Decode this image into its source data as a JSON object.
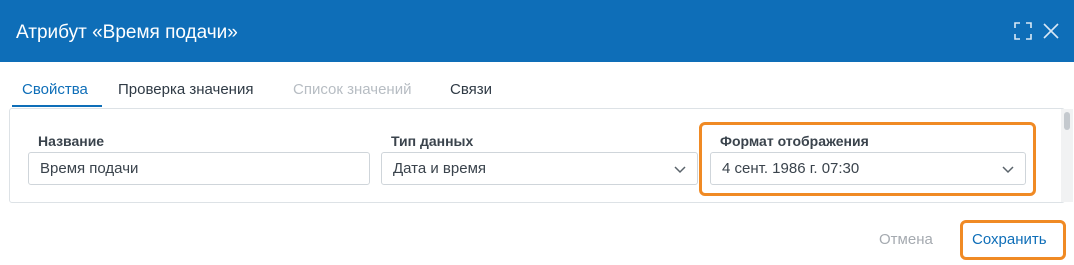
{
  "dialog": {
    "title": "Атрибут «Время подачи»",
    "icons": [
      "expand-icon",
      "close-icon"
    ]
  },
  "tabs": [
    {
      "label": "Свойства",
      "state": "active"
    },
    {
      "label": "Проверка значения",
      "state": "normal"
    },
    {
      "label": "Список значений",
      "state": "disabled"
    },
    {
      "label": "Связи",
      "state": "normal"
    }
  ],
  "fields": {
    "name": {
      "label": "Название",
      "value": "Время подачи"
    },
    "data_type": {
      "label": "Тип данных",
      "value": "Дата и время"
    },
    "display_format": {
      "label": "Формат отображения",
      "value": "4 сент. 1986 г. 07:30"
    }
  },
  "footer": {
    "cancel_label": "Отмена",
    "save_label": "Сохранить"
  },
  "colors": {
    "header": "#0e6eb8",
    "accent": "#0e6eb8",
    "highlight": "#f08a24"
  }
}
